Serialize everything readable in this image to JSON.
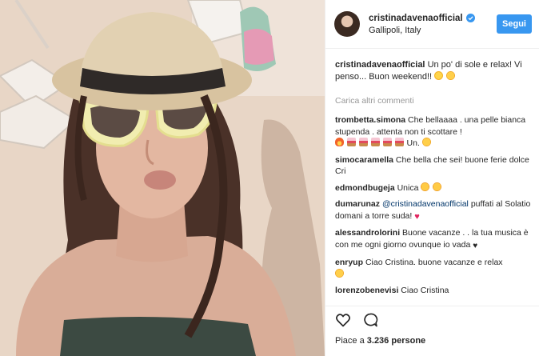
{
  "header": {
    "username": "cristinadavenaofficial",
    "location": "Gallipoli, Italy",
    "follow_label": "Segui"
  },
  "caption": {
    "username": "cristinadavenaofficial",
    "text": "Un po' di sole e relax! Vi penso... Buon weekend!!"
  },
  "load_more_label": "Carica altri commenti",
  "comments": [
    {
      "username": "trombetta.simona",
      "text": "Che bellaaaa . una pelle bianca stupenda . attenta non ti scottare !",
      "tail": "Un."
    },
    {
      "username": "simocaramella",
      "text": "Che bella che sei! buone ferie dolce Cri"
    },
    {
      "username": "edmondbugeja",
      "text": "Unica"
    },
    {
      "username": "dumarunaz",
      "mention": "@cristinadavenaofficial",
      "text": "puffati al Solatio domani a torre suda!"
    },
    {
      "username": "alessandrolorini",
      "text": "Buone vacanze . . la tua musica è con me ogni giorno ovunque io vada"
    },
    {
      "username": "enryup",
      "text": "Ciao Cristina. buone vacanze e relax"
    },
    {
      "username": "lorenzobenevisi",
      "text": "Ciao Cristina"
    }
  ],
  "likes": {
    "prefix": "Piace a",
    "count": "3.236",
    "suffix": "persone"
  },
  "icons": {
    "verified": "verified-badge-icon",
    "like": "heart-outline-icon",
    "comment": "speech-bubble-icon"
  },
  "colors": {
    "accent": "#3897f0",
    "verified": "#3897f0",
    "text": "#262626",
    "muted": "#999999"
  }
}
